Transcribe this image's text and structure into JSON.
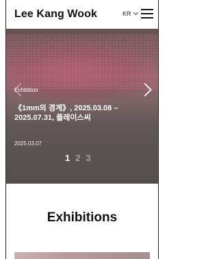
{
  "header": {
    "site_title": "Lee Kang Wook",
    "language": "KR"
  },
  "hero": {
    "category": "Exhibition",
    "title": "《1mm의 경계》, 2025.03.08 – 2025.07.31, 플레이스씨",
    "date": "2025.03.07",
    "pager": [
      "1",
      "2",
      "3"
    ],
    "active_page": 1
  },
  "section": {
    "title": "Exhibitions"
  },
  "icons": {
    "menu": "hamburger-menu-icon",
    "language_toggle": "chevron-down-icon",
    "prev": "chevron-left-icon",
    "next": "chevron-right-icon"
  }
}
